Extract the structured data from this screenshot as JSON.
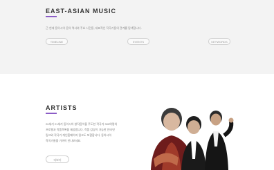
{
  "music": {
    "title": "EAST-ASIAN MUSIC",
    "description": "근·현대 동아시아 음악 역사와 주요 사건들, 대표적인 작곡가들의 관계를 탐색합니다.",
    "buttons": {
      "timeline": "TIMELINE",
      "events": "EVENTS",
      "keywords": "KEYWORDS"
    }
  },
  "artists": {
    "title": "ARTISTS",
    "description_lines": [
      "20세기 21세기 동아시아 창작음악을 주도한 작곡가 300여명의",
      "프로필과 작품목록을 제공합니다. 작품 감상이 가능한 인터넷",
      "링크와 작곡가 개인홈페이지 링크도 포함합니다. 동아시아",
      "작곡가들을 가까이 만나보세요."
    ],
    "more_button": "더보기"
  },
  "colors": {
    "accent": "#8b5cc6",
    "band_background": "#f3f3f3"
  }
}
